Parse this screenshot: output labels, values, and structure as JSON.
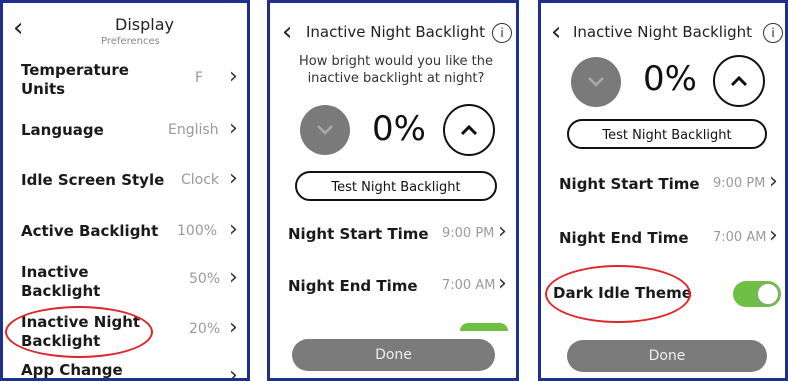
{
  "screen1": {
    "title": "Display",
    "subtitle": "Preferences",
    "back_icon": "chevron-left-icon",
    "rows": [
      {
        "label": "Temperature Units",
        "value": "F"
      },
      {
        "label": "Language",
        "value": "English"
      },
      {
        "label": "Idle Screen Style",
        "value": "Clock"
      },
      {
        "label": "Active Backlight",
        "value": "100%"
      },
      {
        "label": "Inactive Backlight",
        "value": "50%"
      },
      {
        "label": "Inactive Night Backlight",
        "value": "20%"
      },
      {
        "label": "App Change",
        "value": ""
      }
    ],
    "highlight_color": "#e0252b"
  },
  "screen2": {
    "title": "Inactive Night Backlight",
    "info_icon": "info-icon",
    "prompt": "How bright would you like the inactive backlight at night?",
    "percent": "0%",
    "test_button": "Test Night Backlight",
    "rows": [
      {
        "label": "Night Start Time",
        "value": "9:00 PM"
      },
      {
        "label": "Night End Time",
        "value": "7:00 AM"
      }
    ],
    "done_button": "Done"
  },
  "screen3": {
    "title": "Inactive Night Backlight",
    "info_icon": "info-icon",
    "percent": "0%",
    "test_button": "Test Night Backlight",
    "rows": [
      {
        "label": "Night Start Time",
        "value": "9:00 PM"
      },
      {
        "label": "Night End Time",
        "value": "7:00 AM"
      },
      {
        "label": "Dark Idle Theme",
        "value": ""
      }
    ],
    "toggle_on": true,
    "toggle_color": "#6fbf44",
    "done_button": "Done"
  }
}
